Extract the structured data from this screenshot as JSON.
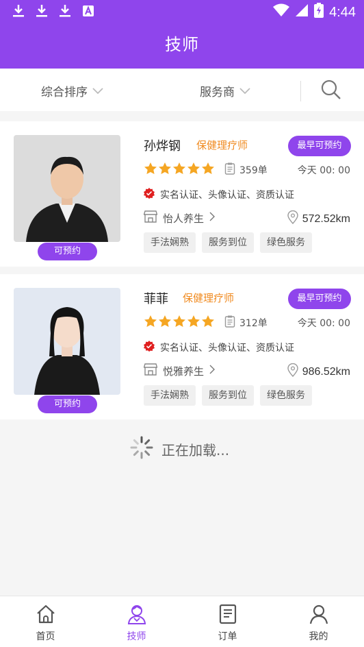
{
  "status_bar": {
    "time": "4:44",
    "icons": [
      "download-icon",
      "download-icon",
      "download-icon",
      "font-a-icon",
      "wifi-icon",
      "signal-icon",
      "battery-icon"
    ]
  },
  "header": {
    "title": "技师"
  },
  "filter": {
    "sort_label": "综合排序",
    "provider_label": "服务商"
  },
  "technicians": [
    {
      "name": "孙烨钢",
      "role": "保健理疗师",
      "earliest_label": "最早可预约",
      "available_label": "可预约",
      "rating_stars": 5,
      "orders": "359单",
      "time": "今天 00: 00",
      "certs": "实名认证、头像认证、资质认证",
      "shop": "怡人养生",
      "distance": "572.52km",
      "tags": [
        "手法娴熟",
        "服务到位",
        "绿色服务"
      ]
    },
    {
      "name": "菲菲",
      "role": "保健理疗师",
      "earliest_label": "最早可预约",
      "available_label": "可预约",
      "rating_stars": 5,
      "orders": "312单",
      "time": "今天 00: 00",
      "certs": "实名认证、头像认证、资质认证",
      "shop": "悦雅养生",
      "distance": "986.52km",
      "tags": [
        "手法娴熟",
        "服务到位",
        "绿色服务"
      ]
    }
  ],
  "loading": {
    "text": "正在加载..."
  },
  "tabbar": {
    "items": [
      {
        "label": "首页"
      },
      {
        "label": "技师"
      },
      {
        "label": "订单"
      },
      {
        "label": "我的"
      }
    ],
    "active": 1
  },
  "colors": {
    "accent": "#8f45ec",
    "role": "#f08a1f",
    "star": "#f5a623"
  }
}
